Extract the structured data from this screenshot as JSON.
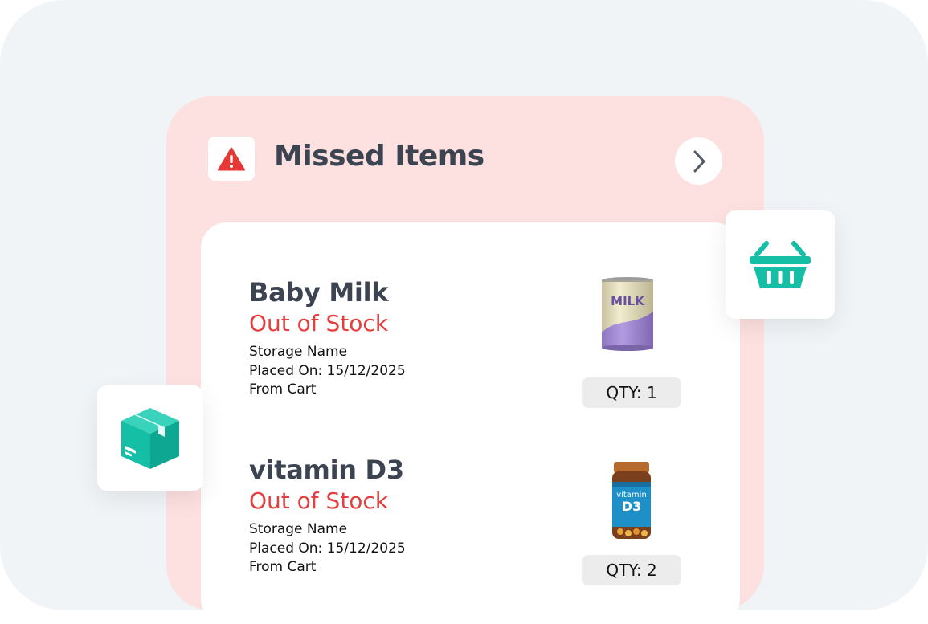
{
  "header": {
    "title": "Missed Items",
    "warning_icon": "warning-triangle-icon",
    "next_icon": "chevron-right-icon"
  },
  "items": [
    {
      "name": "Baby Milk",
      "status": "Out of Stock",
      "storage": "Storage Name",
      "placed_on": "Placed On: 15/12/2025",
      "source": "From Cart",
      "qty": "QTY: 1",
      "image_label": "MILK",
      "image_icon": "milk-can-icon"
    },
    {
      "name": "vitamin D3",
      "status": "Out of Stock",
      "storage": "Storage Name",
      "placed_on": "Placed On: 15/12/2025",
      "source": "From Cart",
      "qty": "QTY: 2",
      "image_label_top": "vitamin",
      "image_label_main": "D3",
      "image_icon": "vitamin-bottle-icon"
    }
  ],
  "floating": {
    "basket_icon": "shopping-basket-icon",
    "package_icon": "package-box-icon"
  },
  "colors": {
    "background": "#f1f4f7",
    "card": "#fde0e0",
    "accent_teal": "#14bfa6",
    "status_red": "#e53e3e",
    "warning_red": "#e53935",
    "title_text": "#3d4451"
  }
}
